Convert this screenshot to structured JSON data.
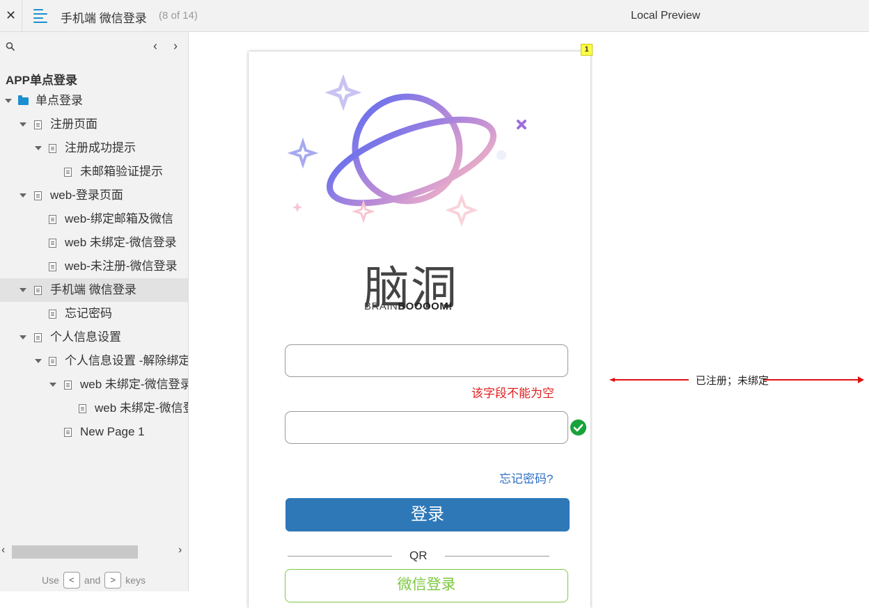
{
  "topbar": {
    "close_glyph": "✕",
    "page_title": "手机端 微信登录",
    "page_count": "(8 of 14)",
    "preview_label": "Local Preview"
  },
  "sidebar": {
    "prev_glyph": "‹",
    "next_glyph": "›",
    "project_title": "APP单点登录",
    "items": [
      {
        "label": "单点登录",
        "icon": "folder-icon",
        "expanded": true
      },
      {
        "label": "注册页面",
        "icon": "page-icon",
        "expanded": true
      },
      {
        "label": "注册成功提示",
        "icon": "page-icon",
        "expanded": true
      },
      {
        "label": "未邮箱验证提示",
        "icon": "page-icon"
      },
      {
        "label": "web-登录页面",
        "icon": "page-icon",
        "expanded": true
      },
      {
        "label": "web-绑定邮箱及微信",
        "icon": "page-icon"
      },
      {
        "label": "web 未绑定-微信登录",
        "icon": "page-icon"
      },
      {
        "label": "web-未注册-微信登录",
        "icon": "page-icon"
      },
      {
        "label": "手机端 微信登录",
        "icon": "page-icon",
        "expanded": true,
        "selected": true
      },
      {
        "label": "忘记密码",
        "icon": "page-icon"
      },
      {
        "label": "个人信息设置",
        "icon": "page-icon",
        "expanded": true
      },
      {
        "label": "个人信息设置 -解除绑定",
        "icon": "page-icon",
        "expanded": true
      },
      {
        "label": "web 未绑定-微信登录",
        "icon": "page-icon",
        "expanded": true
      },
      {
        "label": "web 未绑定-微信登录",
        "icon": "page-icon"
      },
      {
        "label": "New Page 1",
        "icon": "page-icon"
      }
    ],
    "scroll_left_glyph": "‹",
    "scroll_right_glyph": "›",
    "hint_use": "Use",
    "hint_and": "and",
    "hint_keys": "keys",
    "key_prev": "<",
    "key_next": ">"
  },
  "preview": {
    "note_badge": "1",
    "logo_zh": "脑洞",
    "logo_en_light": "BRAIN",
    "logo_en_bold": "BOOOOM!",
    "error_message": "该字段不能为空",
    "forgot_password": "忘记密码?",
    "login_button": "登录",
    "qr_label": "QR",
    "wechat_button": "微信登录",
    "annotation": "已注册；未绑定",
    "colors": {
      "accent_blue": "#2e78b8",
      "error_red": "#e02020",
      "success_green": "#18a33a",
      "wechat_green": "#7cc840",
      "annotation_red": "#e01010"
    }
  }
}
